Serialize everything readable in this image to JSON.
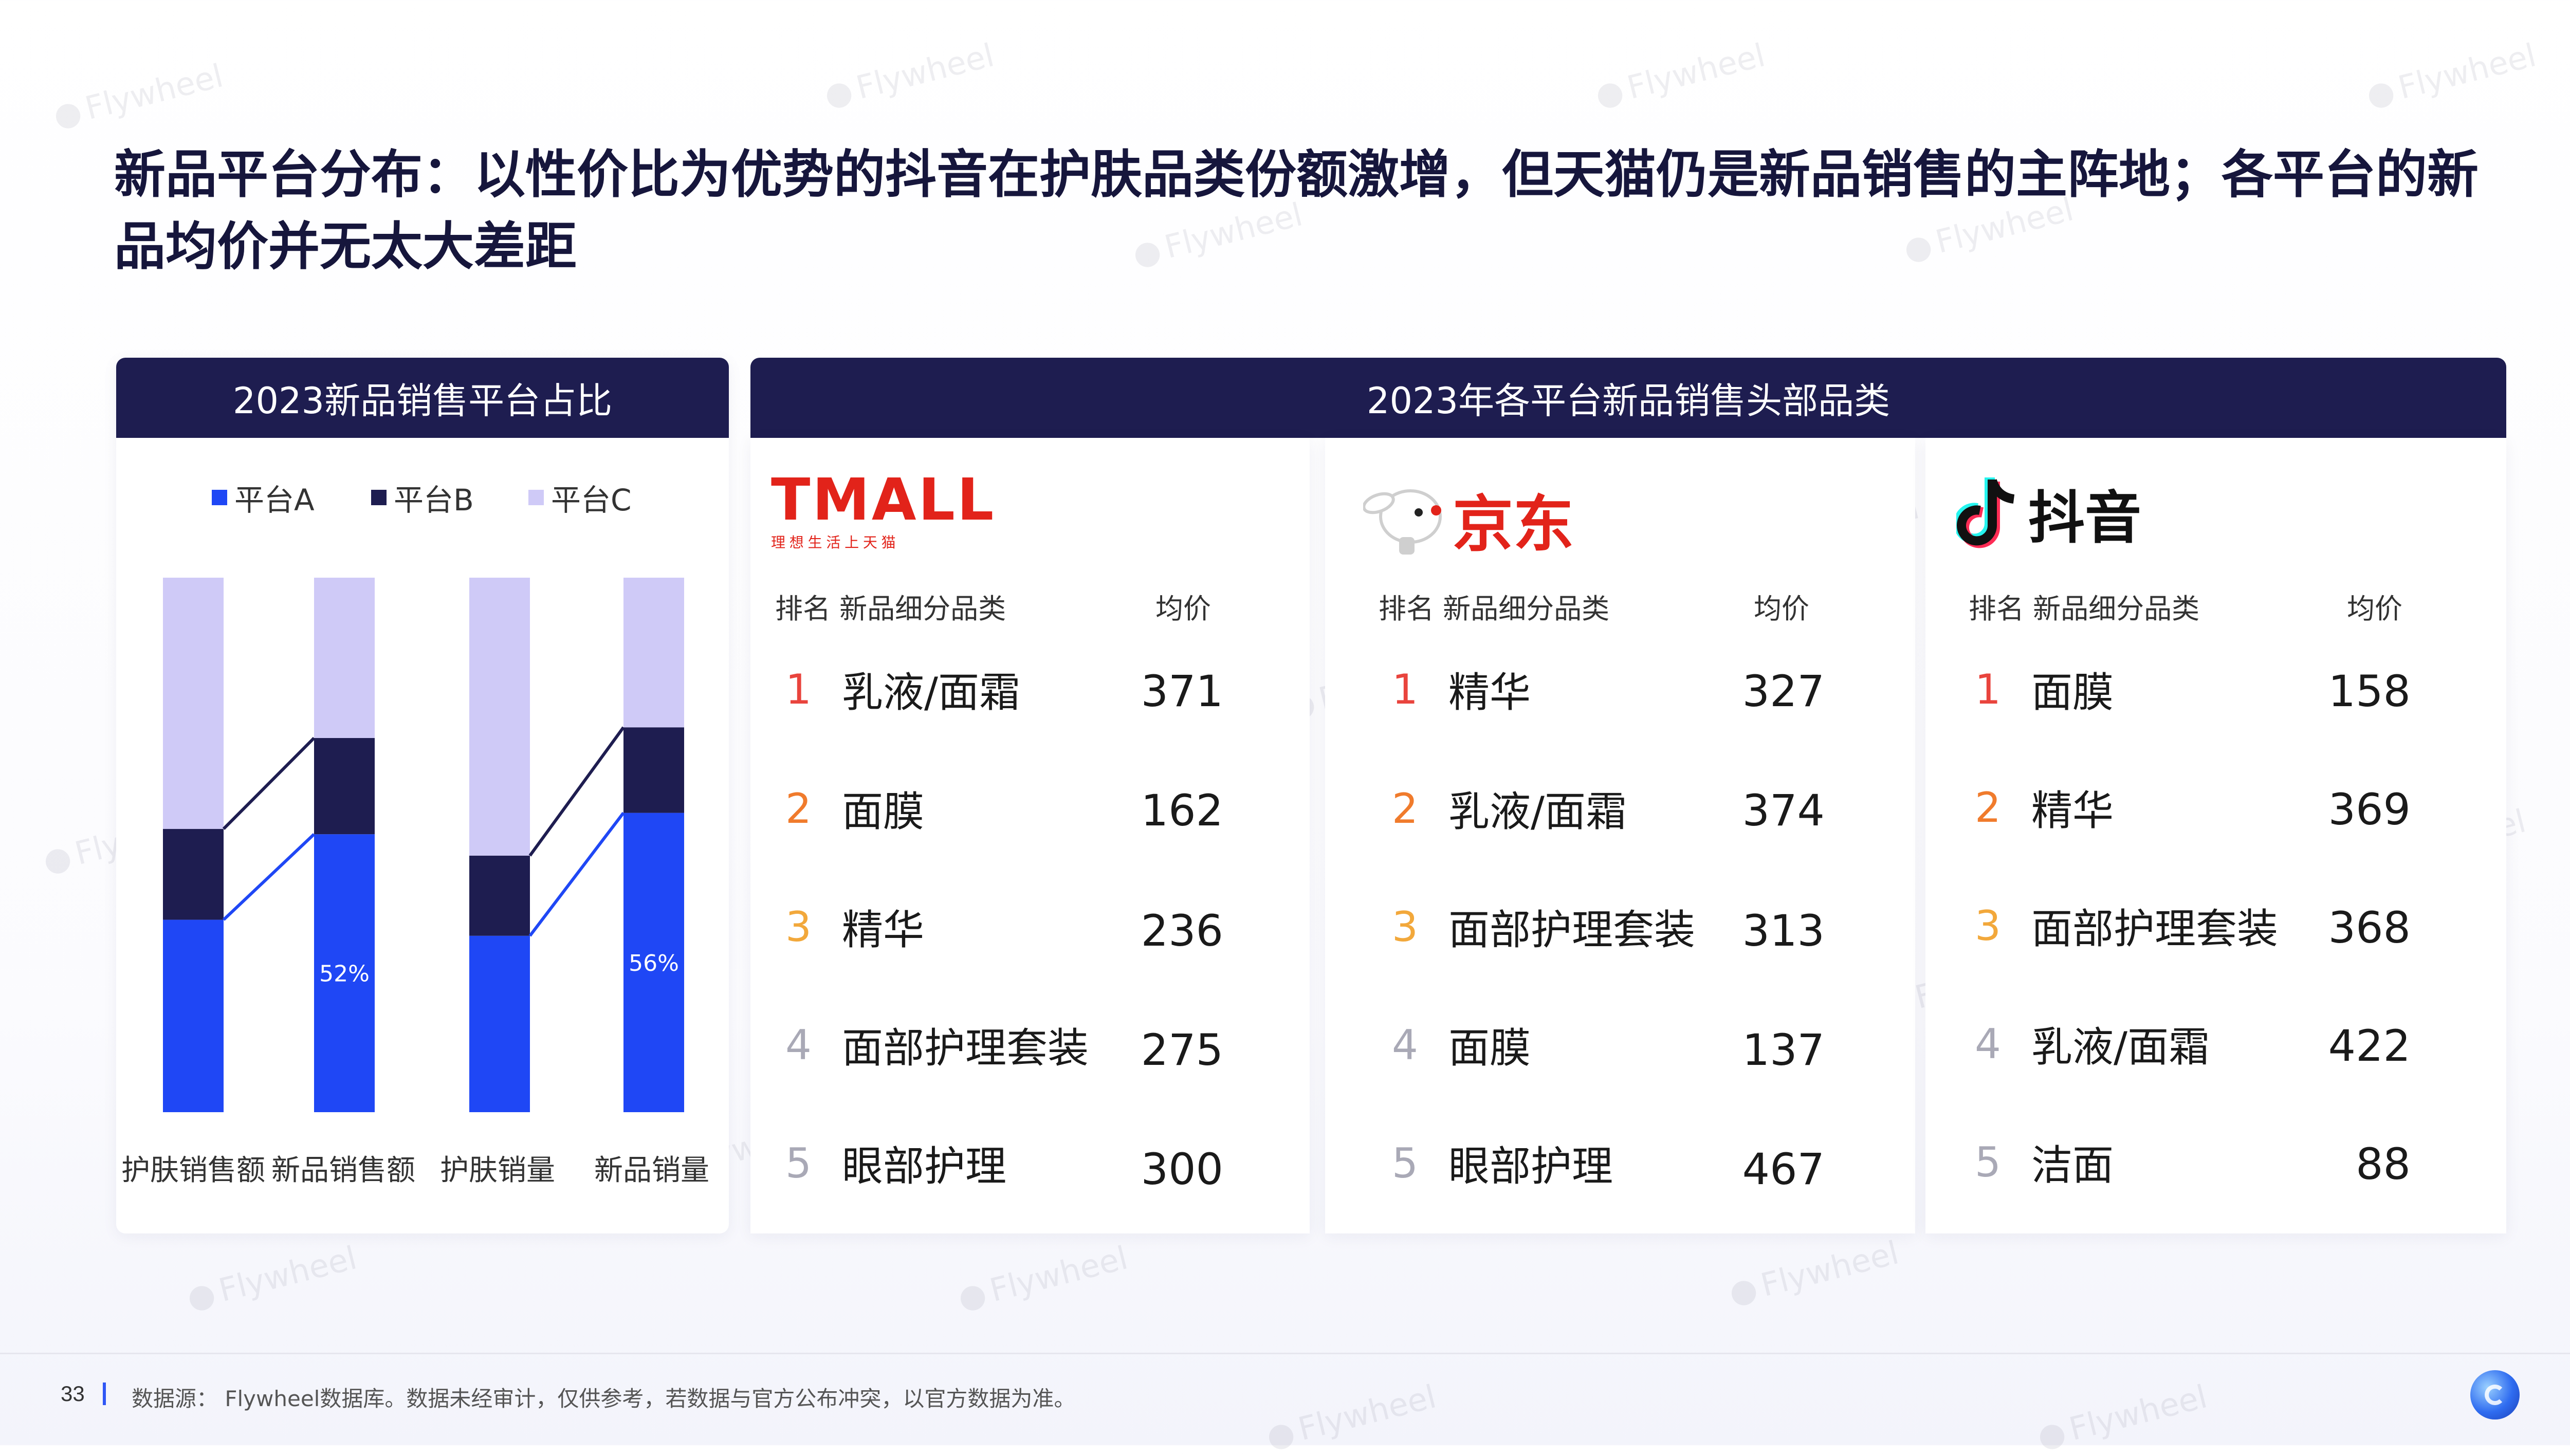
{
  "title": "新品平台分布：以性价比为优势的抖音在护肤品类份额激增，但天猫仍是新品销售的主阵地；各平台的新品均价并无太大差距",
  "left_panel": {
    "header": "2023新品销售平台占比"
  },
  "right_panel": {
    "header": "2023年各平台新品销售头部品类"
  },
  "chart_data": {
    "type": "bar",
    "stacked": true,
    "categories": [
      "护肤销售额",
      "新品销售额",
      "护肤销量",
      "新品销量"
    ],
    "series": [
      {
        "name": "平台A",
        "values": [
          36,
          52,
          33,
          56
        ],
        "color": "#1f47f5"
      },
      {
        "name": "平台B",
        "values": [
          17,
          18,
          15,
          16
        ],
        "color": "#1e1d50"
      },
      {
        "name": "平台C",
        "values": [
          47,
          30,
          52,
          28
        ],
        "color": "#cfcaf7"
      }
    ],
    "data_labels": {
      "新品销售额": "52%",
      "新品销量": "56%"
    },
    "legend_position": "top",
    "ylim": [
      0,
      100
    ],
    "connectors": [
      [
        0,
        1
      ],
      [
        2,
        3
      ]
    ]
  },
  "platforms": [
    {
      "name": "TMALL",
      "tagline": "理 想 生 活 上 天 猫",
      "col_rank_cat": "排名 新品细分品类",
      "col_price": "均价",
      "rows": [
        {
          "rank": "1",
          "category": "乳液/面霜",
          "price": "371"
        },
        {
          "rank": "2",
          "category": "面膜",
          "price": "162"
        },
        {
          "rank": "3",
          "category": "精华",
          "price": "236"
        },
        {
          "rank": "4",
          "category": "面部护理套装",
          "price": "275"
        },
        {
          "rank": "5",
          "category": "眼部护理",
          "price": "300"
        }
      ]
    },
    {
      "name": "京东",
      "col_rank_cat": "排名 新品细分品类",
      "col_price": "均价",
      "rows": [
        {
          "rank": "1",
          "category": "精华",
          "price": "327"
        },
        {
          "rank": "2",
          "category": "乳液/面霜",
          "price": "374"
        },
        {
          "rank": "3",
          "category": "面部护理套装",
          "price": "313"
        },
        {
          "rank": "4",
          "category": "面膜",
          "price": "137"
        },
        {
          "rank": "5",
          "category": "眼部护理",
          "price": "467"
        }
      ]
    },
    {
      "name": "抖音",
      "col_rank_cat": "排名 新品细分品类",
      "col_price": "均价",
      "rows": [
        {
          "rank": "1",
          "category": "面膜",
          "price": "158"
        },
        {
          "rank": "2",
          "category": "精华",
          "price": "369"
        },
        {
          "rank": "3",
          "category": "面部护理套装",
          "price": "368"
        },
        {
          "rank": "4",
          "category": "乳液/面霜",
          "price": "422"
        },
        {
          "rank": "5",
          "category": "洁面",
          "price": "88"
        }
      ]
    }
  ],
  "footer": {
    "page_number": "33",
    "source": "数据源： Flywheel数据库。数据未经审计，仅供参考，若数据与官方公布冲突，以官方数据为准。"
  },
  "watermark": "Flywheel",
  "icons": {
    "brand_logo": "flywheel-logo-icon",
    "douyin_logo": "douyin-note-icon",
    "jd_logo": "jd-dog-icon"
  }
}
